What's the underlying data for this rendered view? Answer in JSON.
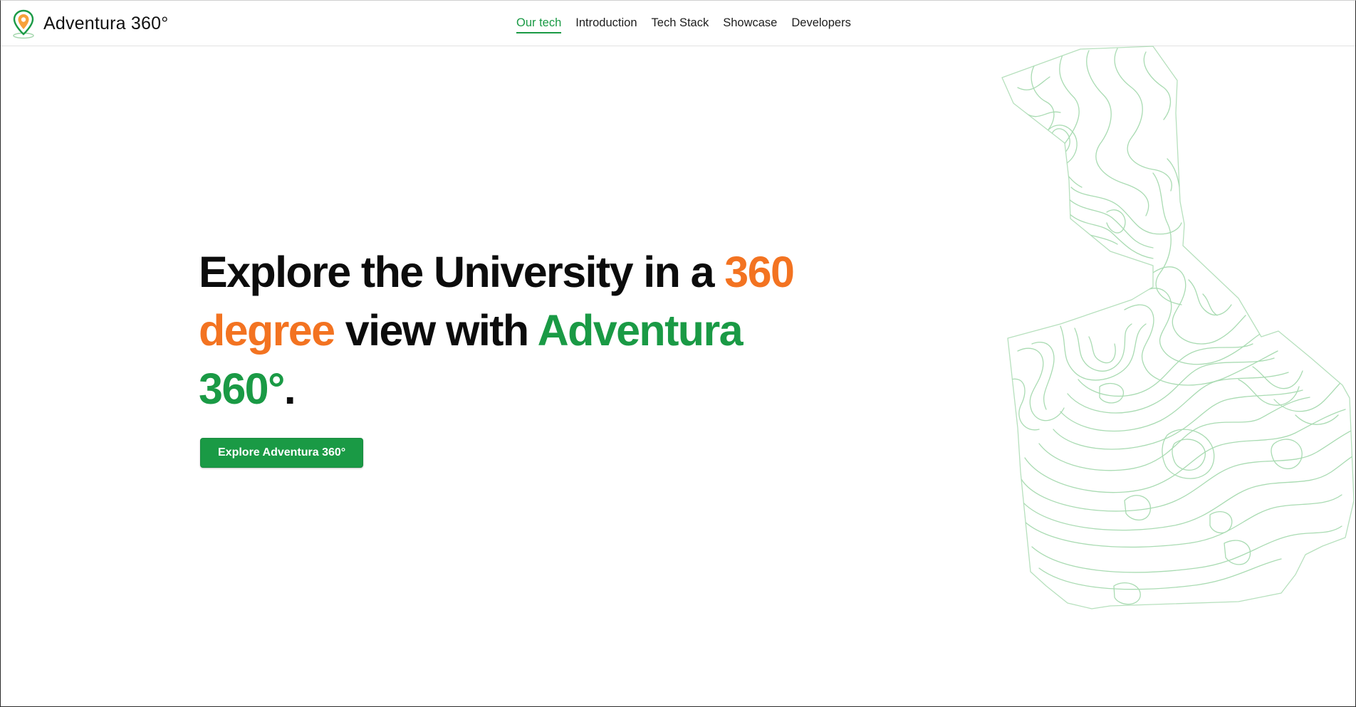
{
  "header": {
    "brand_name": "Adventura 360°",
    "logo_icon": "map-pin-logo-icon",
    "nav": [
      {
        "label": "Our tech",
        "active": true
      },
      {
        "label": "Introduction",
        "active": false
      },
      {
        "label": "Tech Stack",
        "active": false
      },
      {
        "label": "Showcase",
        "active": false
      },
      {
        "label": "Developers",
        "active": false
      }
    ]
  },
  "hero": {
    "title_parts": {
      "p1": "Explore the University in a ",
      "p2": "360 degree",
      "p3": " view with ",
      "p4": "Adventura 360°",
      "p5": "."
    },
    "cta_label": "Explore Adventura 360°"
  },
  "colors": {
    "brand_green": "#1a9a45",
    "accent_orange": "#f37321",
    "text_dark": "#0c0c0c",
    "topo_line": "#9fd4a9"
  },
  "decoration": {
    "topo_icon": "topographic-map-illustration"
  }
}
